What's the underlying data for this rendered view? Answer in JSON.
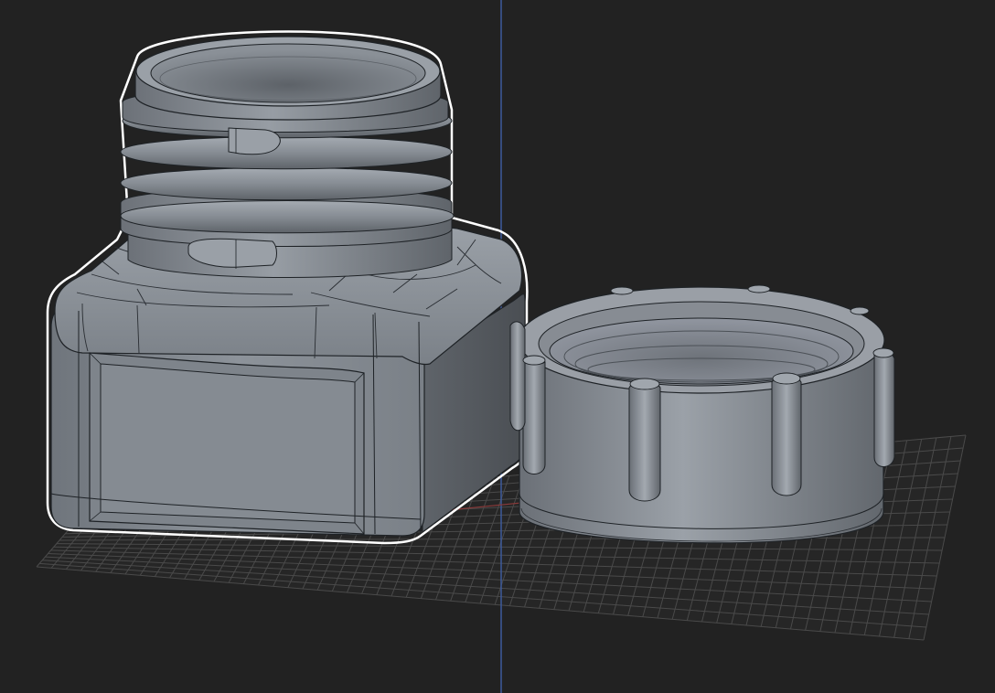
{
  "viewport": {
    "background_color": "#222222",
    "grid_color": "#4a4a4a",
    "y_axis_color": "#3d5a9c",
    "x_axis_color": "#8a3a3a",
    "selection_outline_color": "#ffffff",
    "model_color": "#8a9098",
    "edge_color": "#1e2226"
  },
  "objects": [
    {
      "name": "threaded-bottle",
      "selected": true
    },
    {
      "name": "screw-cap",
      "selected": false
    }
  ]
}
